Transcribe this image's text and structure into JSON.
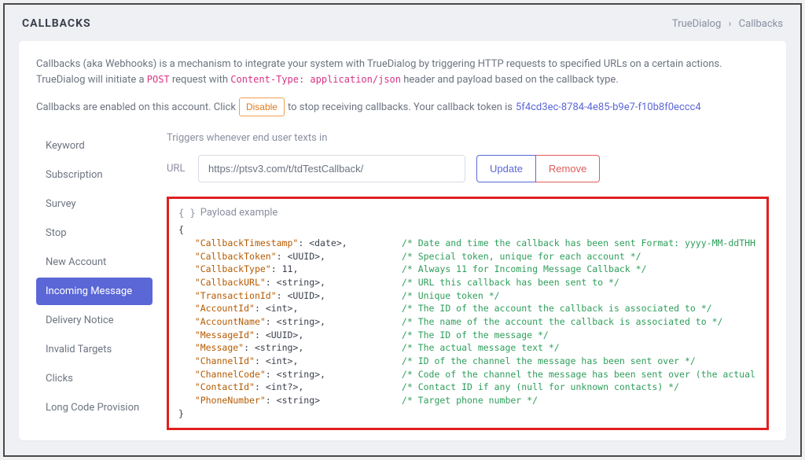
{
  "header": {
    "title": "CALLBACKS",
    "breadcrumb_root": "TrueDialog",
    "breadcrumb_leaf": "Callbacks"
  },
  "intro": {
    "line1_a": "Callbacks (aka Webhooks) is a mechanism to integrate your system with TrueDialog by triggering HTTP requests to specified URLs on a certain actions. TrueDialog will initiate a ",
    "post": "POST",
    "line1_b": " request with ",
    "ct": "Content-Type: application/json",
    "line1_c": " header and payload based on the callback type."
  },
  "enabled": {
    "pre": "Callbacks are enabled on this account. Click",
    "disable": "Disable",
    "mid": "to stop receiving callbacks. Your callback token is",
    "token": "5f4cd3ec-8784-4e85-b9e7-f10b8f0eccc4"
  },
  "sidebar": {
    "items": [
      "Keyword",
      "Subscription",
      "Survey",
      "Stop",
      "New Account",
      "Incoming Message",
      "Delivery Notice",
      "Invalid Targets",
      "Clicks",
      "Long Code Provision"
    ],
    "active_index": 5
  },
  "main": {
    "trigger": "Triggers whenever end user texts in",
    "url_label": "URL",
    "url_value": "https://ptsv3.com/t/tdTestCallback/",
    "update": "Update",
    "remove": "Remove",
    "payload_title": "Payload example"
  },
  "payload": {
    "fields": [
      {
        "key": "CallbackTimestamp",
        "val": "<date>",
        "comment": "Date and time the callback has been sent Format: yyyy-MM-ddTHH:mm:ss"
      },
      {
        "key": "CallbackToken",
        "val": "<UUID>",
        "comment": "Special token, unique for each account"
      },
      {
        "key": "CallbackType",
        "val": "11",
        "comment": "Always 11 for Incoming Message Callback"
      },
      {
        "key": "CallbackURL",
        "val": "<string>",
        "comment": "URL this callback has been sent to"
      },
      {
        "key": "TransactionId",
        "val": "<UUID>",
        "comment": "Unique token"
      },
      {
        "key": "AccountId",
        "val": "<int>",
        "comment": "The ID of the account the callback is associated to"
      },
      {
        "key": "AccountName",
        "val": "<string>",
        "comment": "The name of the account the callback is associated to"
      },
      {
        "key": "MessageId",
        "val": "<UUID>",
        "comment": "The ID of the message"
      },
      {
        "key": "Message",
        "val": "<string>",
        "comment": "The actual message text"
      },
      {
        "key": "ChannelId",
        "val": "<int>",
        "comment": "ID of the channel the message has been sent over"
      },
      {
        "key": "ChannelCode",
        "val": "<string>",
        "comment": "Code of the channel the message has been sent over (the actual phone number for long code)"
      },
      {
        "key": "ContactId",
        "val": "<int?>",
        "comment": "Contact ID if any (null for unknown contacts)"
      },
      {
        "key": "PhoneNumber",
        "val": "<string>",
        "comment": "Target phone number"
      }
    ],
    "key_col_width": 38
  }
}
